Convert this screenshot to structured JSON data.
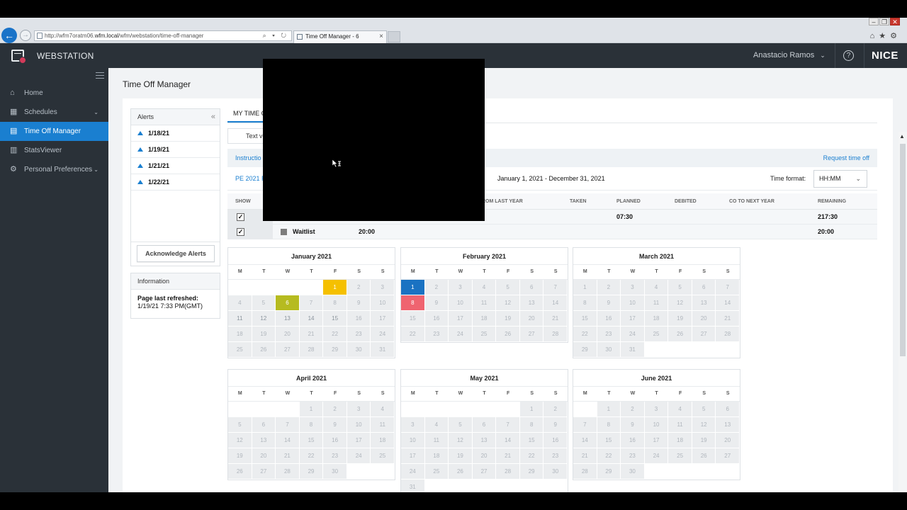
{
  "browser": {
    "url_prefix": "http://wfm7oratm06.",
    "url_domain": "wfm.local",
    "url_suffix": "/wfm/webstation/time-off-manager",
    "tab_title": "Time Off Manager - 6",
    "tab_close": "×",
    "addr_tools": "⌕ ▾ ↻"
  },
  "header": {
    "app_name": "WEBSTATION",
    "user_name": "Anastacio Ramos",
    "brand": "NICE"
  },
  "sidebar": {
    "items": [
      {
        "label": "Home",
        "icon": "home-icon"
      },
      {
        "label": "Schedules",
        "icon": "calendar-icon",
        "expandable": true
      },
      {
        "label": "Time Off Manager",
        "icon": "time-off-icon",
        "active": true
      },
      {
        "label": "StatsViewer",
        "icon": "stats-icon"
      },
      {
        "label": "Personal Preferences",
        "icon": "preferences-icon",
        "expandable": true
      }
    ]
  },
  "page": {
    "title": "Time Off Manager"
  },
  "alerts": {
    "title": "Alerts",
    "items": [
      "1/18/21",
      "1/19/21",
      "1/21/21",
      "1/22/21"
    ],
    "ack_label": "Acknowledge Alerts"
  },
  "info": {
    "title": "Information",
    "label": "Page last refreshed:",
    "value": "1/19/21 7:33 PM(GMT)"
  },
  "main": {
    "tab_label": "MY TIME O",
    "text_view_label": "Text v",
    "instructions_label": "Instructio",
    "request_label": "Request time off",
    "plan_name": "PE 2021 R",
    "plan_range": "January 1, 2021 - December 31, 2021",
    "time_format_label": "Time format:",
    "time_format_value": "HH:MM"
  },
  "summary": {
    "columns": {
      "show": "SHOW",
      "from_last_year": "ROM LAST YEAR",
      "taken": "TAKEN",
      "planned": "PLANNED",
      "debited": "DEBITED",
      "co_next": "CO TO NEXT YEAR",
      "remaining": "REMAINING"
    },
    "rows": [
      {
        "label": "",
        "swatch": "#2a3bb8",
        "allotment": "",
        "planned": "07:30",
        "remaining": "217:30"
      },
      {
        "label": "Waitlist",
        "swatch": "#7d7d7d",
        "allotment": "20:00",
        "planned": "",
        "remaining": "20:00"
      }
    ]
  },
  "calendars": [
    {
      "title": "January 2021",
      "start": 4,
      "days": 31,
      "events": {
        "1": "ev-yellow",
        "6": "ev-green"
      },
      "weekdays": [
        6,
        11,
        12,
        13,
        14,
        15
      ]
    },
    {
      "title": "February 2021",
      "start": 0,
      "days": 28,
      "events": {
        "1": "ev-blue",
        "8": "ev-red"
      },
      "weekdays": []
    },
    {
      "title": "March 2021",
      "start": 0,
      "days": 31,
      "events": {},
      "weekdays": []
    },
    {
      "title": "April 2021",
      "start": 3,
      "days": 30,
      "events": {},
      "weekdays": []
    },
    {
      "title": "May 2021",
      "start": 5,
      "days": 31,
      "events": {},
      "weekdays": []
    },
    {
      "title": "June 2021",
      "start": 1,
      "days": 30,
      "events": {},
      "weekdays": []
    }
  ],
  "dow": [
    "M",
    "T",
    "W",
    "T",
    "F",
    "S",
    "S"
  ],
  "colors": {
    "accent": "#1a7fd0",
    "header_bg": "#2a3138",
    "event_yellow": "#f5c000",
    "event_green": "#b6bb20",
    "event_blue": "#1a72c2",
    "event_red": "#ef6470"
  }
}
